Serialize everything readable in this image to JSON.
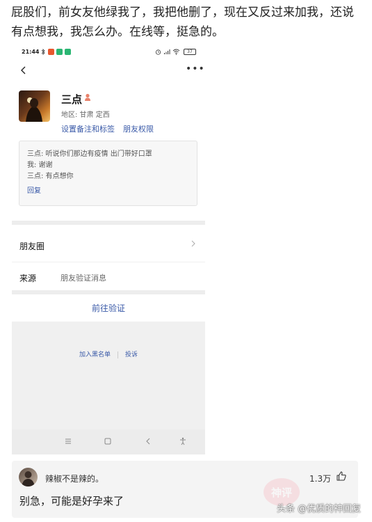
{
  "post": {
    "text": "屁股们，前女友他绿我了，我把他删了，现在又反过来加我，还说有点想我，我怎么办。在线等，挺急的。"
  },
  "status_bar": {
    "time": "21:44",
    "battery": "37"
  },
  "profile": {
    "name": "三点",
    "region": "地区: 甘肃  定西",
    "set_remark": "设置备注和标签",
    "friend_permission": "朋友权限"
  },
  "message_box": {
    "lines": [
      "三点: 听说你们那边有疫情 出门带好口罩",
      "我: 谢谢",
      "三点: 有点想你"
    ],
    "reply": "回复"
  },
  "rows": {
    "moments": "朋友圈",
    "source_label": "来源",
    "source_value": "朋友验证消息"
  },
  "verify_button": "前往验证",
  "actions": {
    "blacklist": "加入黑名单",
    "report": "投诉"
  },
  "comment": {
    "username": "辣椒不是辣的。",
    "likes": "1.3万",
    "text": "别急，可能是好孕来了"
  },
  "watermark": "头条 @优质的神回复",
  "stamp_text": "神评",
  "colors": {
    "link_blue": "#3a5aa8",
    "gray_bg": "#f0f0f0"
  },
  "icons": [
    "back-icon",
    "more-icon",
    "gender-icon",
    "chevron-right-icon",
    "like-icon"
  ]
}
